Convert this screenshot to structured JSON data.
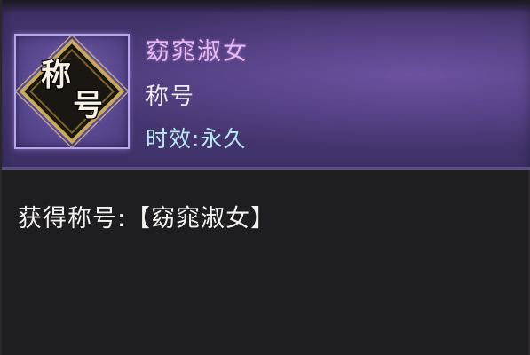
{
  "item": {
    "name": "窈窕淑女",
    "type": "称号",
    "duration": "时效:永久",
    "badge_chars": [
      "称",
      "号"
    ]
  },
  "description": "获得称号:【窈窕淑女】",
  "colors": {
    "name": "#e6b8f0",
    "type": "#f2eef6",
    "duration": "#b9e7f0",
    "header_bg": "#4a3a78",
    "body_bg": "#1e1d20"
  },
  "icons": {
    "badge": "title-badge-icon"
  }
}
